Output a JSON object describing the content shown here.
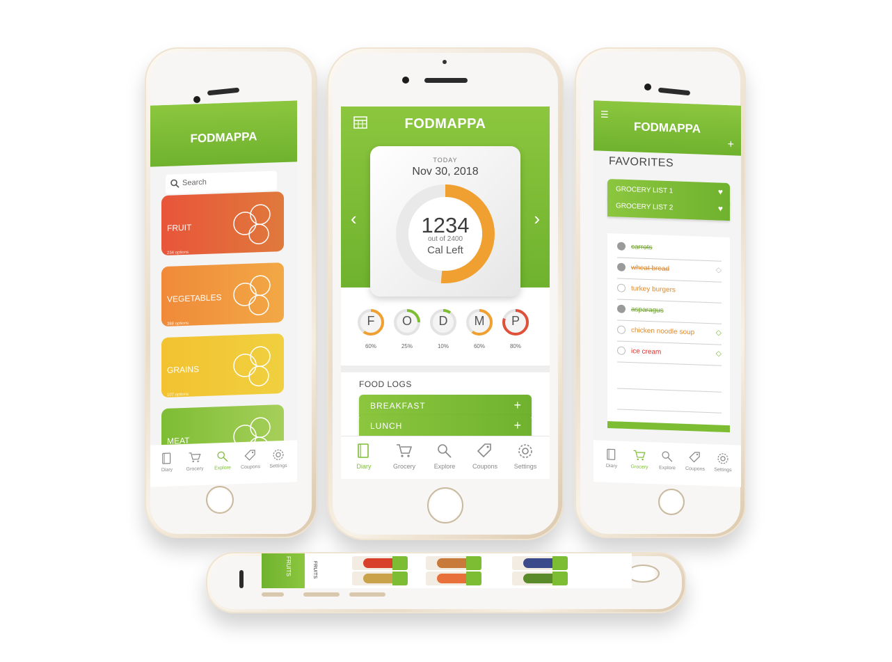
{
  "center": {
    "app_title": "FODMAPPA",
    "today_label": "TODAY",
    "date": "Nov 30, 2018",
    "calories_left": "1234",
    "calories_total": "out of 2400",
    "cal_left_label": "Cal Left",
    "calorie_fraction_remaining": 0.514,
    "macros": [
      {
        "letter": "F",
        "pct": "60%",
        "value": 0.6,
        "color": "#f0a030"
      },
      {
        "letter": "O",
        "pct": "25%",
        "value": 0.25,
        "color": "#7dbd34"
      },
      {
        "letter": "D",
        "pct": "10%",
        "value": 0.1,
        "color": "#7dbd34"
      },
      {
        "letter": "M",
        "pct": "60%",
        "value": 0.6,
        "color": "#f0a030"
      },
      {
        "letter": "P",
        "pct": "80%",
        "value": 0.8,
        "color": "#e0513a"
      }
    ],
    "food_logs_title": "FOOD LOGS",
    "food_logs": [
      {
        "label": "BREAKFAST"
      },
      {
        "label": "LUNCH"
      }
    ],
    "tabs": [
      {
        "label": "Diary",
        "icon": "book-icon",
        "active": true
      },
      {
        "label": "Grocery",
        "icon": "cart-icon",
        "active": false
      },
      {
        "label": "Explore",
        "icon": "magnifier-icon",
        "active": false
      },
      {
        "label": "Coupons",
        "icon": "tag-icon",
        "active": false
      },
      {
        "label": "Settings",
        "icon": "gear-icon",
        "active": false
      }
    ]
  },
  "left": {
    "app_title": "FODMAPPA",
    "search_placeholder": "Search",
    "categories": [
      {
        "name": "FRUIT",
        "count": "234 options",
        "color_a": "#e8553a",
        "color_b": "#e0793c"
      },
      {
        "name": "VEGETABLES",
        "count": "388 options",
        "color_a": "#f08a3a",
        "color_b": "#f2a845"
      },
      {
        "name": "GRAINS",
        "count": "107 options",
        "color_a": "#f2c230",
        "color_b": "#f0d040"
      },
      {
        "name": "MEAT",
        "count": "",
        "color_a": "#7dbd34",
        "color_b": "#a6cf5a"
      }
    ],
    "tabs": [
      {
        "label": "Diary",
        "icon": "book-icon",
        "active": false
      },
      {
        "label": "Grocery",
        "icon": "cart-icon",
        "active": false
      },
      {
        "label": "Explore",
        "icon": "magnifier-icon",
        "active": true
      },
      {
        "label": "Coupons",
        "icon": "tag-icon",
        "active": false
      },
      {
        "label": "Settings",
        "icon": "gear-icon",
        "active": false
      }
    ]
  },
  "right": {
    "app_title": "FODMAPPA",
    "favorites_title": "FAVORITES",
    "grocery_lists": [
      {
        "label": "GROCERY LIST 1"
      },
      {
        "label": "GROCERY LIST 2"
      }
    ],
    "items": [
      {
        "text": "carrots",
        "done": true,
        "color": "#6fa12c",
        "tag": false
      },
      {
        "text": "wheat bread",
        "done": true,
        "color": "#e08a2c",
        "tag": true
      },
      {
        "text": "turkey burgers",
        "done": false,
        "color": "#e08a2c",
        "tag": false
      },
      {
        "text": "asparagus",
        "done": true,
        "color": "#6fa12c",
        "tag": false
      },
      {
        "text": "chicken noodle soup",
        "done": false,
        "color": "#e08a2c",
        "tag": true
      },
      {
        "text": "ice cream",
        "done": false,
        "color": "#e0302c",
        "tag": true
      }
    ],
    "tabs": [
      {
        "label": "Diary",
        "icon": "book-icon",
        "active": false
      },
      {
        "label": "Grocery",
        "icon": "cart-icon",
        "active": true
      },
      {
        "label": "Explore",
        "icon": "magnifier-icon",
        "active": false
      },
      {
        "label": "Coupons",
        "icon": "tag-icon",
        "active": false
      },
      {
        "label": "Settings",
        "icon": "gear-icon",
        "active": false
      }
    ]
  },
  "bottom": {
    "header_label": "FRUITS",
    "side_label": "FRUITS"
  },
  "colors": {
    "brand_green": "#7dbd34",
    "brand_green_light": "#8cc63f",
    "accent_orange": "#f0a030"
  }
}
